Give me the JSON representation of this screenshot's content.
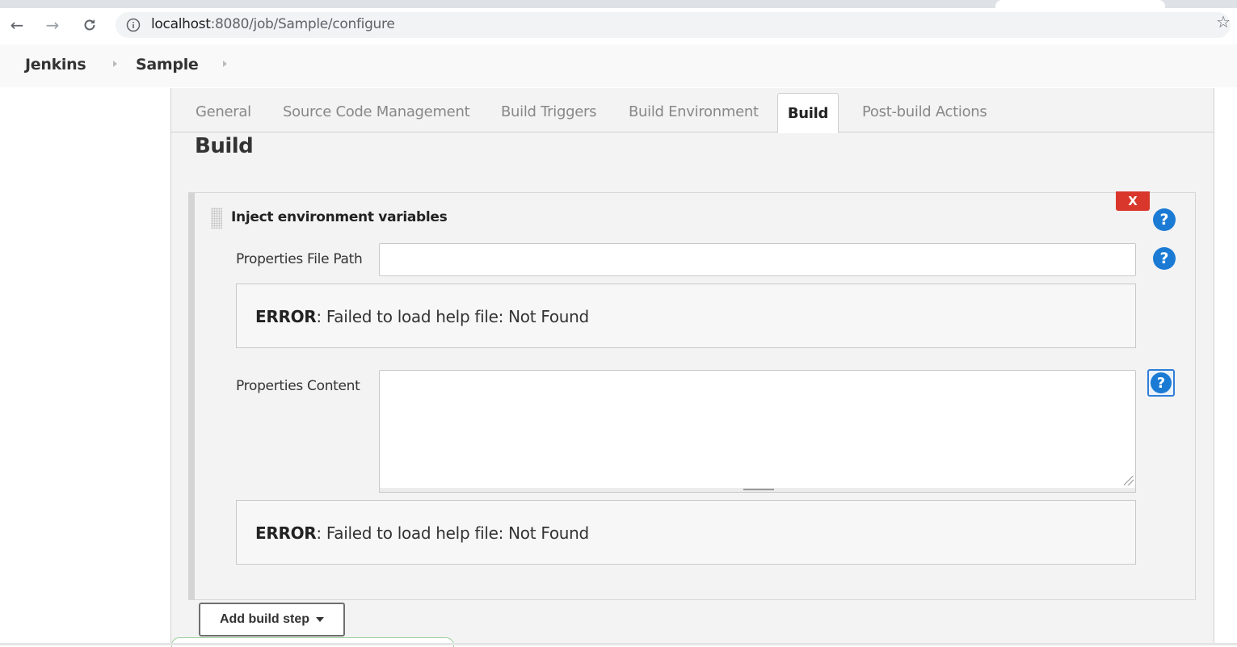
{
  "browser": {
    "url_host": "localhost",
    "url_rest": ":8080/job/Sample/configure",
    "back_icon": "arrow-left-icon",
    "forward_icon": "arrow-right-icon",
    "reload_icon": "reload-icon",
    "bookmark_icon": "star-icon"
  },
  "breadcrumbs": {
    "items": [
      "Jenkins",
      "Sample"
    ]
  },
  "tabs": {
    "items": [
      "General",
      "Source Code Management",
      "Build Triggers",
      "Build Environment",
      "Build",
      "Post-build Actions"
    ],
    "active": "Build"
  },
  "section": {
    "title": "Build"
  },
  "step": {
    "title": "Inject environment variables",
    "delete_label": "X",
    "help_glyph": "?",
    "fields": {
      "properties_file_path": {
        "label": "Properties File Path",
        "value": ""
      },
      "properties_content": {
        "label": "Properties Content",
        "value": ""
      }
    },
    "help_error_strong": "ERROR",
    "help_error_text": ": Failed to load help file: Not Found"
  },
  "add_step": {
    "label": "Add build step"
  },
  "colors": {
    "delete_red": "#d9372b",
    "help_blue": "#1a7ad4",
    "panel_bg": "#f3f3f3"
  }
}
